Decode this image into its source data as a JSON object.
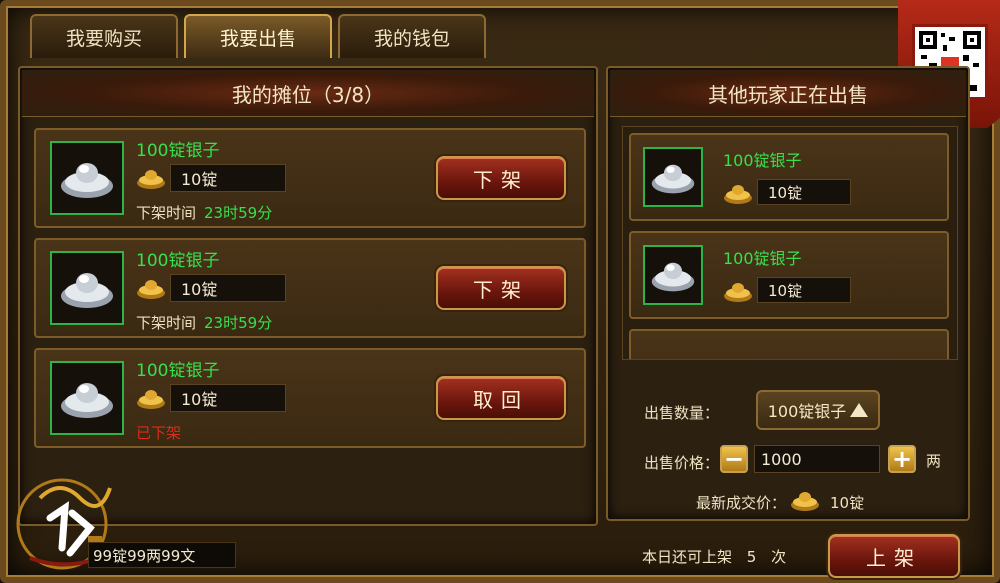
{
  "tabs": [
    {
      "label": "我要购买"
    },
    {
      "label": "我要出售"
    },
    {
      "label": "我的钱包"
    }
  ],
  "left_panel": {
    "title": "我的摊位（3/8）",
    "items": [
      {
        "name": "100锭银子",
        "price": "10锭",
        "time_label": "下架时间",
        "time_value": "23时59分",
        "button": "下架"
      },
      {
        "name": "100锭银子",
        "price": "10锭",
        "time_label": "下架时间",
        "time_value": "23时59分",
        "button": "下架"
      },
      {
        "name": "100锭银子",
        "price": "10锭",
        "status": "已下架",
        "button": "取回"
      }
    ]
  },
  "right_panel": {
    "title": "其他玩家正在出售",
    "items": [
      {
        "name": "100锭银子",
        "price": "10锭"
      },
      {
        "name": "100锭银子",
        "price": "10锭"
      }
    ],
    "sell_qty_label": "出售数量：",
    "sell_qty_value": "100锭银子",
    "sell_price_label": "出售价格：",
    "sell_price_value": "1000",
    "sell_price_unit": "两",
    "last_price_label": "最新成交价：",
    "last_price_value": "10锭"
  },
  "bottom": {
    "currency": "99锭99两99文",
    "remaining_text": "本日还可上架",
    "remaining_count": "5",
    "remaining_unit": "次",
    "list_button": "上架"
  },
  "colors": {
    "accent_green": "#36e04d",
    "removed_red": "#e12a1a",
    "gold": "#c79a4a"
  }
}
